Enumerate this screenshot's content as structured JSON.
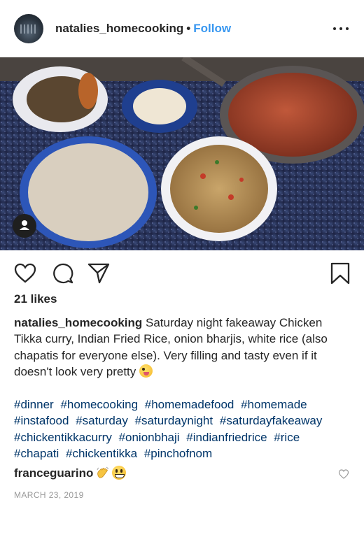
{
  "header": {
    "username": "natalies_homecooking",
    "separator": "•",
    "follow_label": "Follow",
    "avatar_icon": "avatar-icon",
    "more_icon": "more-options-icon"
  },
  "photo": {
    "description_icon": "food-photo",
    "user_tag_icon": "user-tag-icon"
  },
  "actions": {
    "like_icon": "heart-icon",
    "comment_icon": "comment-icon",
    "share_icon": "share-icon",
    "save_icon": "bookmark-icon"
  },
  "likes": "21 likes",
  "caption": {
    "username": "natalies_homecooking",
    "text": "Saturday night fakeaway Chicken Tikka curry, Indian Fried Rice, onion bharjis, white rice (also chapatis for everyone else). Very filling and tasty even if it doesn't look very pretty"
  },
  "hashtags": [
    "#dinner",
    "#homecooking",
    "#homemadefood",
    "#homemade",
    "#instafood",
    "#saturday",
    "#saturdaynight",
    "#saturdayfakeaway",
    "#chickentikkacurry",
    "#onionbhaji",
    "#indianfriedrice",
    "#rice",
    "#chapati",
    "#chickentikka",
    "#pinchofnom"
  ],
  "comment": {
    "username": "franceguarino",
    "heart_icon": "comment-heart-icon"
  },
  "date": "MARCH 23, 2019",
  "colors": {
    "link": "#3897f0",
    "hashtag": "#003569",
    "text": "#262626",
    "muted": "#999999"
  }
}
